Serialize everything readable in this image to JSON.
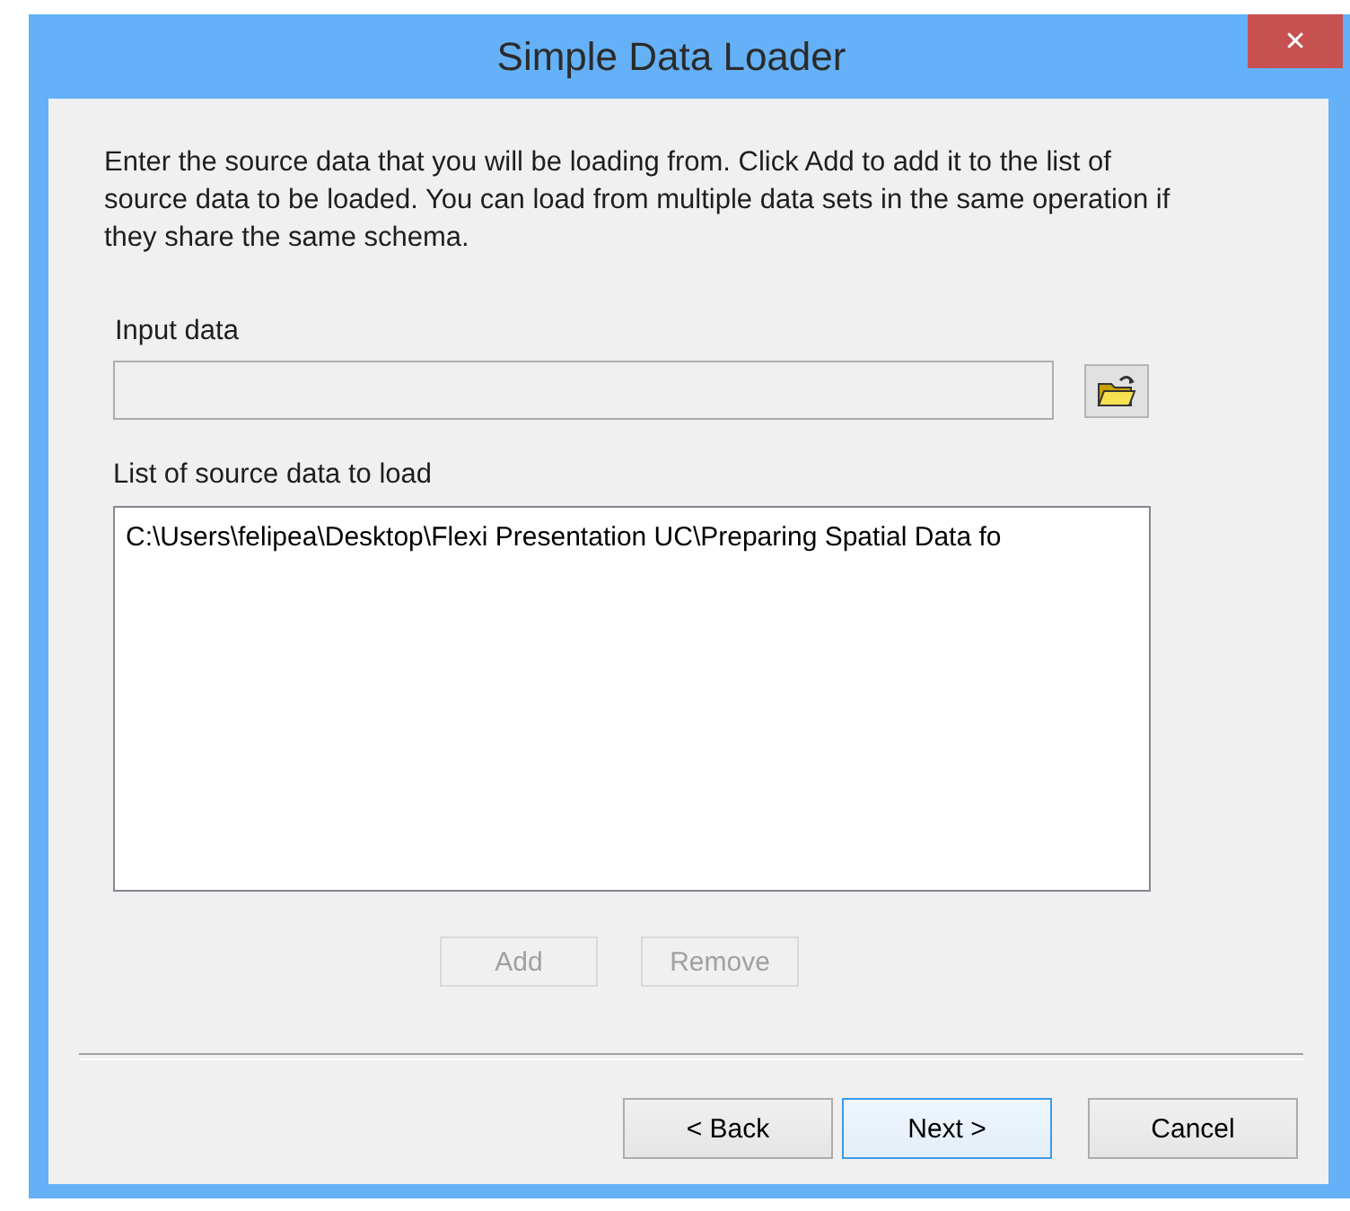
{
  "window": {
    "title": "Simple Data Loader",
    "close": "✕"
  },
  "description": "Enter the source data that you will be loading from. Click Add to add it to the list of source data to be loaded. You can load from multiple data sets in the same operation if they share the same schema.",
  "input": {
    "label": "Input data"
  },
  "source_list": {
    "label": "List of source data to load",
    "items": [
      {
        "text": "C:\\Users\\felipea\\Desktop\\Flexi Presentation UC\\Preparing Spatial Data fo"
      }
    ]
  },
  "list_buttons": [
    {
      "label": "Add",
      "disabled": true
    },
    {
      "label": "Remove",
      "disabled": true
    }
  ],
  "nav_buttons": [
    {
      "label": "< Back",
      "focused": false
    },
    {
      "label": "Next >",
      "focused": true
    },
    {
      "label": "Cancel",
      "focused": false
    }
  ]
}
